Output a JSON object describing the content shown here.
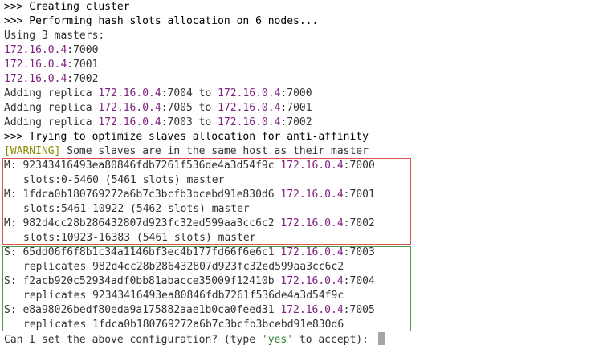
{
  "terminal": {
    "l1": ">>> Creating cluster",
    "l2": ">>> Performing hash slots allocation on 6 nodes...",
    "l3": "Using 3 masters:",
    "m1": {
      "ip": "172.16.0.4",
      "port": ":7000"
    },
    "m2": {
      "ip": "172.16.0.4",
      "port": ":7001"
    },
    "m3": {
      "ip": "172.16.0.4",
      "port": ":7002"
    },
    "r1": {
      "a": "Adding replica ",
      "ip1": "172.16.0.4",
      "p1": ":7004",
      "to": " to ",
      "ip2": "172.16.0.4",
      "p2": ":7000"
    },
    "r2": {
      "a": "Adding replica ",
      "ip1": "172.16.0.4",
      "p1": ":7005",
      "to": " to ",
      "ip2": "172.16.0.4",
      "p2": ":7001"
    },
    "r3": {
      "a": "Adding replica ",
      "ip1": "172.16.0.4",
      "p1": ":7003",
      "to": " to ",
      "ip2": "172.16.0.4",
      "p2": ":7002"
    },
    "l10": ">>> Trying to optimize slaves allocation for anti-affinity",
    "warn_tag": "[WARNING]",
    "warn_text": " Some slaves are in the same host as their master",
    "masters": [
      {
        "prefix": "M: ",
        "id": "92343416493ea80846fdb7261f536de4a3d54f9c ",
        "ip": "172.16.0.4",
        "port": ":7000",
        "detail": "slots:0-5460 (5461 slots) master"
      },
      {
        "prefix": "M: ",
        "id": "1fdca0b180769272a6b7c3bcfb3bcebd91e830d6 ",
        "ip": "172.16.0.4",
        "port": ":7001",
        "detail": "slots:5461-10922 (5462 slots) master"
      },
      {
        "prefix": "M: ",
        "id": "982d4cc28b286432807d923fc32ed599aa3cc6c2 ",
        "ip": "172.16.0.4",
        "port": ":7002",
        "detail": "slots:10923-16383 (5461 slots) master"
      }
    ],
    "slaves": [
      {
        "prefix": "S: ",
        "id": "65dd06f6f8b1c34a1146bf3ec4b177fd66f6e6c1 ",
        "ip": "172.16.0.4",
        "port": ":7003",
        "detail": "replicates 982d4cc28b286432807d923fc32ed599aa3cc6c2"
      },
      {
        "prefix": "S: ",
        "id": "f2acb920c52934adf0bb81abacce35009f12410b ",
        "ip": "172.16.0.4",
        "port": ":7004",
        "detail": "replicates 92343416493ea80846fdb7261f536de4a3d54f9c"
      },
      {
        "prefix": "S: ",
        "id": "e8a98026bedf80eda9a175882aae1b0ca0feed31 ",
        "ip": "172.16.0.4",
        "port": ":7005",
        "detail": "replicates 1fdca0b180769272a6b7c3bcfb3bcebd91e830d6"
      }
    ],
    "prompt_a": "Can I set the above configuration? (type ",
    "prompt_yes": "'yes'",
    "prompt_b": " to accept): ",
    "colors": {
      "ip": "#7d1f7f",
      "warning": "#8a8a00",
      "master_box": "#d9534f",
      "slave_box": "#4a9a4a"
    }
  }
}
